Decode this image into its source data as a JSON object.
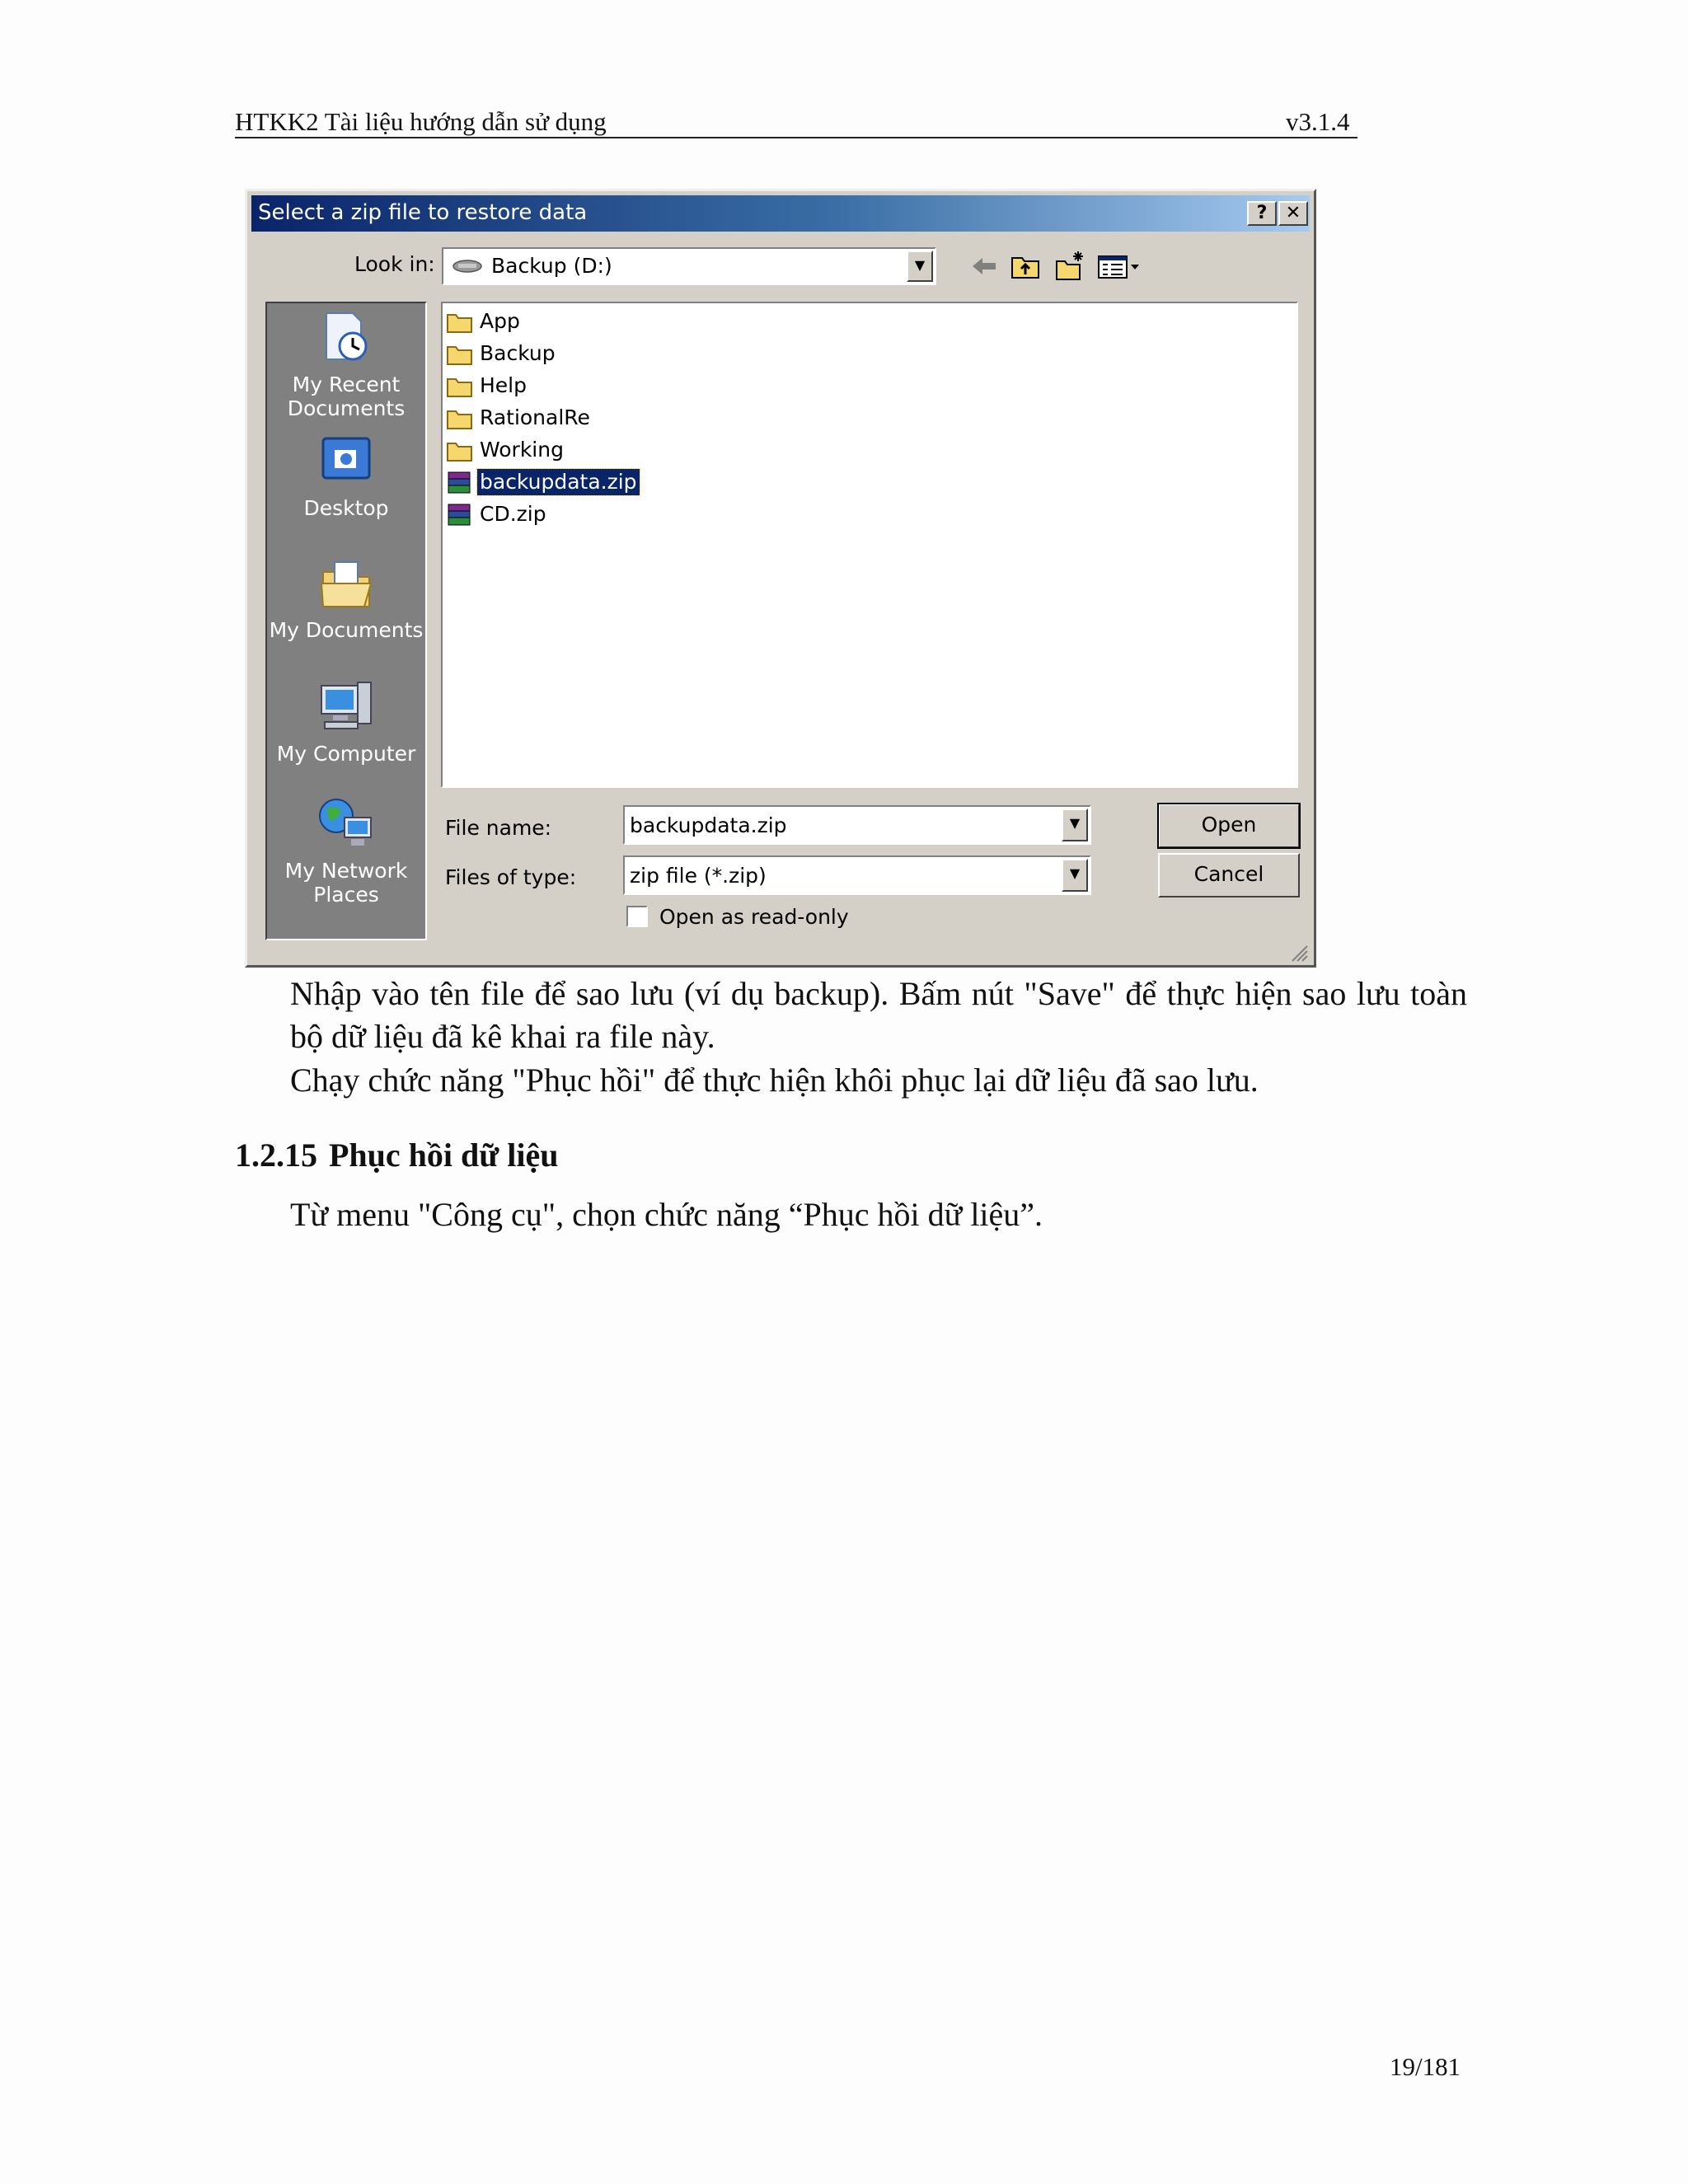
{
  "header": {
    "title": "HTKK2 Tài liệu hướng dẫn sử dụng",
    "version": "v3.1.4"
  },
  "dialog": {
    "title": "Select a zip file to restore data",
    "help_label": "?",
    "close_label": "✕",
    "look_in_label": "Look in:",
    "look_in_value": "Backup (D:)",
    "places": [
      {
        "label_line1": "My Recent",
        "label_line2": "Documents",
        "icon": "recent-documents-icon"
      },
      {
        "label_line1": "Desktop",
        "label_line2": "",
        "icon": "desktop-icon"
      },
      {
        "label_line1": "My Documents",
        "label_line2": "",
        "icon": "my-documents-icon"
      },
      {
        "label_line1": "My Computer",
        "label_line2": "",
        "icon": "my-computer-icon"
      },
      {
        "label_line1": "My Network",
        "label_line2": "Places",
        "icon": "network-places-icon"
      }
    ],
    "files": [
      {
        "name": "App",
        "kind": "folder"
      },
      {
        "name": "Backup",
        "kind": "folder"
      },
      {
        "name": "Help",
        "kind": "folder"
      },
      {
        "name": "RationalRe",
        "kind": "folder"
      },
      {
        "name": "Working",
        "kind": "folder"
      },
      {
        "name": "backupdata.zip",
        "kind": "zip",
        "selected": true
      },
      {
        "name": "CD.zip",
        "kind": "zip"
      }
    ],
    "file_name_label": "File name:",
    "file_name_value": "backupdata.zip",
    "file_type_label": "Files of type:",
    "file_type_value": "zip file (*.zip)",
    "readonly_label": "Open as read-only",
    "readonly_checked": false,
    "open_label": "Open",
    "cancel_label": "Cancel",
    "colors": {
      "titlebar_start": "#0a246a",
      "titlebar_end": "#a6caf0",
      "face": "#d4d0c8",
      "selection": "#0a246a"
    }
  },
  "body": {
    "para1": "Nhập vào tên file để sao lưu (ví dụ backup). Bấm nút \"Save\" để thực hiện sao lưu toàn bộ dữ liệu đã kê khai ra file này.",
    "para2": "Chạy chức năng \"Phục hồi\" để thực hiện khôi phục lại dữ liệu đã sao lưu.",
    "section_number": "1.2.15",
    "section_title": "Phục hồi dữ liệu",
    "para3": "Từ menu \"Công cụ\", chọn chức năng “Phục hồi dữ liệu”."
  },
  "footer": {
    "page": "19/181"
  }
}
